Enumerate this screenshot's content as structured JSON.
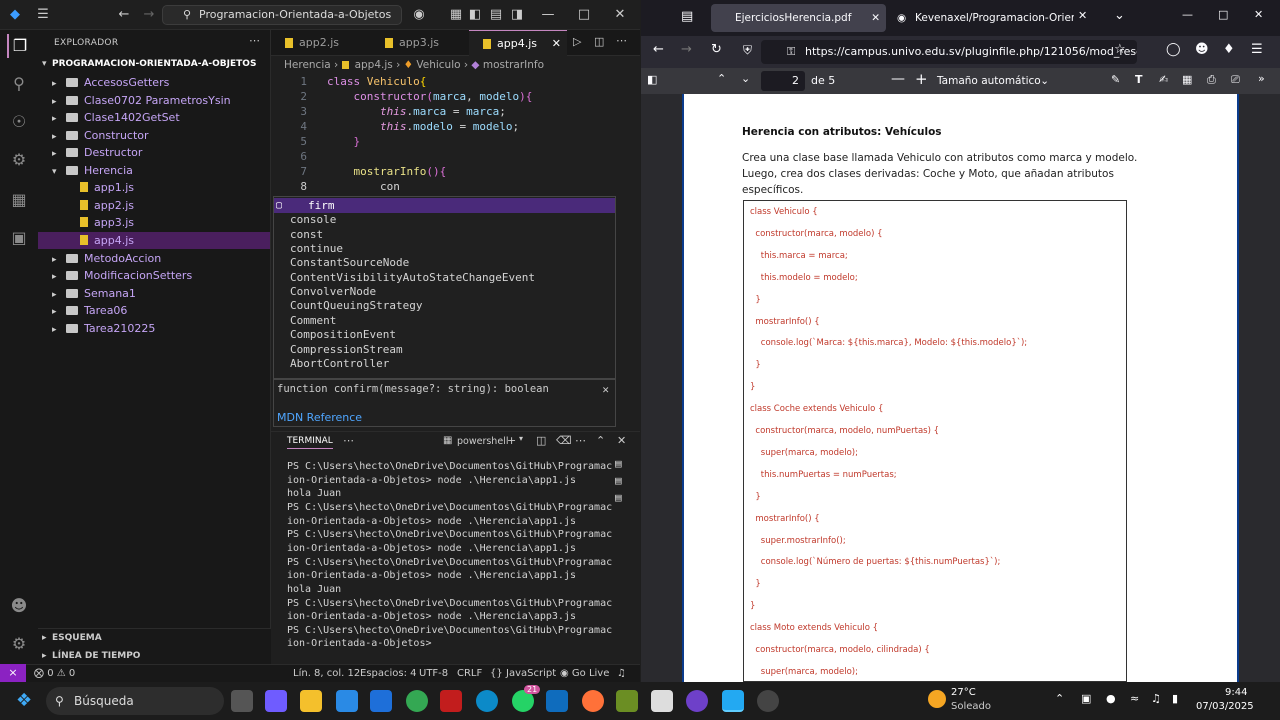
{
  "vscode": {
    "search_text": "Programacion-Orientada-a-Objetos",
    "explorer_title": "EXPLORADOR",
    "project_name": "PROGRAMACION-ORIENTADA-A-OBJETOS",
    "tree": [
      {
        "label": "AccesosGetters",
        "type": "folder"
      },
      {
        "label": "Clase0702 ParametrosYsin",
        "type": "folder"
      },
      {
        "label": "Clase1402GetSet",
        "type": "folder"
      },
      {
        "label": "Constructor",
        "type": "folder"
      },
      {
        "label": "Destructor",
        "type": "folder"
      },
      {
        "label": "Herencia",
        "type": "folder-open"
      },
      {
        "label": "app1.js",
        "type": "file"
      },
      {
        "label": "app2.js",
        "type": "file"
      },
      {
        "label": "app3.js",
        "type": "file"
      },
      {
        "label": "app4.js",
        "type": "file"
      },
      {
        "label": "MetodoAccion",
        "type": "folder"
      },
      {
        "label": "ModificacionSetters",
        "type": "folder"
      },
      {
        "label": "Semana1",
        "type": "folder"
      },
      {
        "label": "Tarea06",
        "type": "folder"
      },
      {
        "label": "Tarea210225",
        "type": "folder"
      }
    ],
    "outline": "ESQUEMA",
    "timeline": "LÍNEA DE TIEMPO",
    "tabs": [
      "app2.js",
      "app3.js",
      "app4.js"
    ],
    "breadcrumb": [
      "Herencia",
      "app4.js",
      "Vehiculo",
      "mostrarInfo"
    ],
    "code_lines": [
      "1",
      "2",
      "3",
      "4",
      "5",
      "6",
      "7",
      "8"
    ],
    "suggestions": [
      "firm",
      "console",
      "const",
      "continue",
      "ConstantSourceNode",
      "ContentVisibilityAutoStateChangeEvent",
      "ConvolverNode",
      "CountQueuingStrategy",
      "Comment",
      "CompositionEvent",
      "CompressionStream",
      "AbortController"
    ],
    "signature": "function confirm(message?: string): boolean",
    "mdn": "MDN Reference",
    "terminal_tab": "TERMINAL",
    "terminal_shell": "powershell",
    "terminal_lines": [
      "PS C:\\Users\\hecto\\OneDrive\\Documentos\\GitHub\\Programac",
      "ion-Orientada-a-Objetos> node .\\Herencia\\app1.js",
      "hola Juan",
      "PS C:\\Users\\hecto\\OneDrive\\Documentos\\GitHub\\Programac",
      "ion-Orientada-a-Objetos> node .\\Herencia\\app1.js",
      "PS C:\\Users\\hecto\\OneDrive\\Documentos\\GitHub\\Programac",
      "ion-Orientada-a-Objetos> node .\\Herencia\\app1.js",
      "PS C:\\Users\\hecto\\OneDrive\\Documentos\\GitHub\\Programac",
      "ion-Orientada-a-Objetos> node .\\Herencia\\app1.js",
      "hola Juan",
      "PS C:\\Users\\hecto\\OneDrive\\Documentos\\GitHub\\Programac",
      "ion-Orientada-a-Objetos> node .\\Herencia\\app3.js",
      "PS C:\\Users\\hecto\\OneDrive\\Documentos\\GitHub\\Programac",
      "ion-Orientada-a-Objetos>"
    ],
    "status": {
      "errors": "0",
      "warnings": "0",
      "position": "Lín. 8, col. 12",
      "spaces": "Espacios: 4",
      "encoding": "UTF-8",
      "eol": "CRLF",
      "lang": "JavaScript",
      "golive": "Go Live"
    }
  },
  "firefox": {
    "tab1": "EjerciciosHerencia.pdf",
    "tab2": "Kevenaxel/Programacion-Orien",
    "url": "https://campus.univo.edu.sv/pluginfile.php/121056/mod_reso",
    "page_current": "2",
    "page_total": "de 5",
    "zoom": "Tamaño automático",
    "pdf_heading": "Herencia con atributos: Vehículos",
    "pdf_text": "Crea una clase base llamada Vehiculo con atributos como marca y modelo. Luego, crea dos clases derivadas: Coche y Moto, que añadan atributos específicos.",
    "pdf_code": [
      "class Vehiculo {",
      "  constructor(marca, modelo) {",
      "    this.marca = marca;",
      "    this.modelo = modelo;",
      "  }",
      "  mostrarInfo() {",
      "    console.log(`Marca: ${this.marca}, Modelo: ${this.modelo}`);",
      "  }",
      "}",
      "class Coche extends Vehiculo {",
      "  constructor(marca, modelo, numPuertas) {",
      "    super(marca, modelo);",
      "    this.numPuertas = numPuertas;",
      "  }",
      "  mostrarInfo() {",
      "    super.mostrarInfo();",
      "    console.log(`Número de puertas: ${this.numPuertas}`);",
      "  }",
      "}",
      "class Moto extends Vehiculo {",
      "  constructor(marca, modelo, cilindrada) {",
      "    super(marca, modelo);"
    ]
  },
  "taskbar": {
    "search": "Búsqueda",
    "weather_temp": "27°C",
    "weather_desc": "Soleado",
    "time": "9:44",
    "date": "07/03/2025",
    "badge": "21"
  }
}
